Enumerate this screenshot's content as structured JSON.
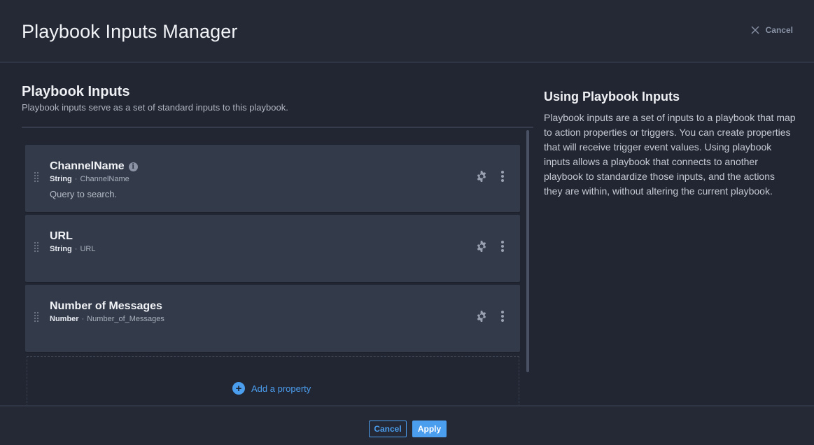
{
  "header": {
    "title": "Playbook Inputs Manager",
    "cancel_label": "Cancel"
  },
  "inputs_section": {
    "title": "Playbook Inputs",
    "subtitle": "Playbook inputs serve as a set of standard inputs to this playbook."
  },
  "inputs": [
    {
      "name": "ChannelName",
      "type": "String",
      "key": "ChannelName",
      "description": "Query to search.",
      "has_info": true
    },
    {
      "name": "URL",
      "type": "String",
      "key": "URL",
      "description": "",
      "has_info": false
    },
    {
      "name": "Number of Messages",
      "type": "Number",
      "key": "Number_of_Messages",
      "description": "",
      "has_info": false
    }
  ],
  "add_property_label": "Add a property",
  "help": {
    "title": "Using Playbook Inputs",
    "body": "Playbook inputs are a set of inputs to a playbook that map to action properties or triggers. You can create properties that will receive trigger event values. Using playbook inputs allows a playbook that connects to another playbook to standardize those inputs, and the actions they are within, without altering the current playbook."
  },
  "footer": {
    "cancel_label": "Cancel",
    "apply_label": "Apply"
  },
  "colors": {
    "accent": "#4b9dee",
    "background": "#222632",
    "card": "#333a4a"
  }
}
